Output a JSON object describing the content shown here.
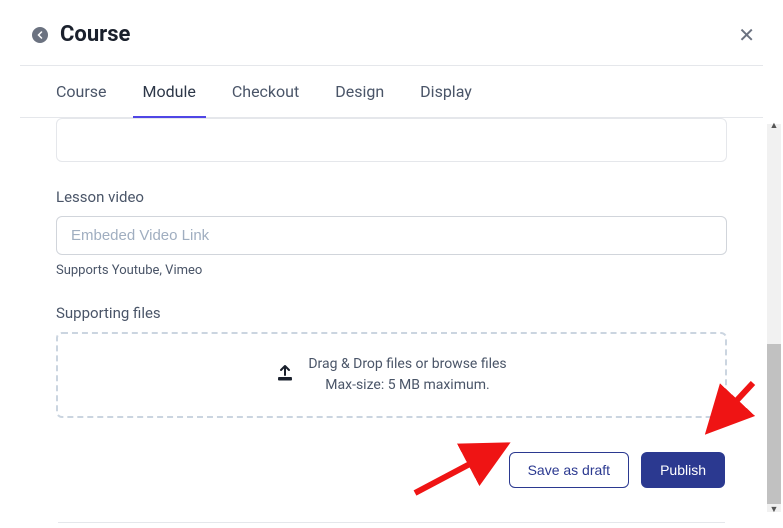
{
  "header": {
    "title": "Course"
  },
  "tabs": {
    "items": [
      {
        "label": "Course"
      },
      {
        "label": "Module"
      },
      {
        "label": "Checkout"
      },
      {
        "label": "Design"
      },
      {
        "label": "Display"
      }
    ]
  },
  "lesson_video": {
    "label": "Lesson video",
    "placeholder": "Embeded Video Link",
    "hint": "Supports Youtube, Vimeo"
  },
  "supporting_files": {
    "label": "Supporting files",
    "drop_line1": "Drag & Drop files or browse files",
    "drop_line2": "Max-size: 5 MB maximum."
  },
  "actions": {
    "save_draft": "Save as draft",
    "publish": "Publish"
  }
}
